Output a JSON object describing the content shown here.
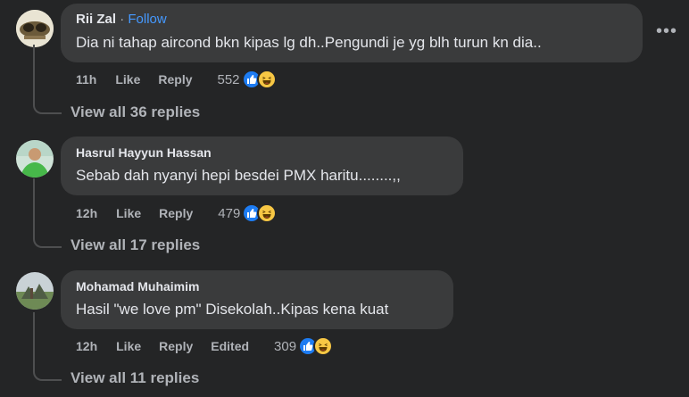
{
  "comments": [
    {
      "name": "Rii Zal",
      "separator": "·",
      "follow": "Follow",
      "text": "Dia ni tahap aircond bkn kipas lg dh..Pengundi je yg blh turun kn dia..",
      "time": "11h",
      "like": "Like",
      "reply": "Reply",
      "count": "552",
      "view_replies": "View all 36 replies"
    },
    {
      "name": "Hasrul Hayyun Hassan",
      "text": "Sebab dah nyanyi hepi besdei PMX haritu........,,",
      "time": "12h",
      "like": "Like",
      "reply": "Reply",
      "count": "479",
      "view_replies": "View all 17 replies"
    },
    {
      "name": "Mohamad Muhaimim",
      "text": "Hasil \"we love pm\" Disekolah..Kipas kena kuat",
      "time": "12h",
      "like": "Like",
      "reply": "Reply",
      "edited": "Edited",
      "count": "309",
      "view_replies": "View all 11 replies"
    }
  ],
  "more_menu": "•••",
  "colors": {
    "background": "#242526",
    "bubble": "#3a3b3c",
    "link": "#4599ff",
    "like": "#1d7cf2",
    "haha": "#f7c744"
  }
}
